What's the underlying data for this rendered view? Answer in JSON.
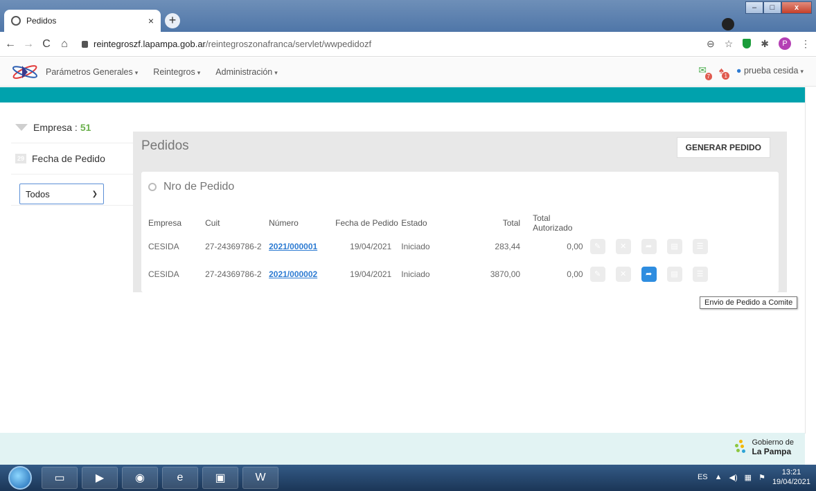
{
  "browser": {
    "tab_title": "Pedidos",
    "tab_close": "×",
    "new_tab": "+",
    "url_domain": "reintegroszf.lapampa.gob.ar",
    "url_path": "/reintegroszonafranca/servlet/wwpedidozf",
    "profile_initial": "P",
    "window_buttons": {
      "minimize": "–",
      "maximize": "□",
      "close": "x"
    }
  },
  "nav": {
    "items": [
      {
        "label": "Parámetros Generales"
      },
      {
        "label": "Reintegros"
      },
      {
        "label": "Administración"
      }
    ],
    "mail_count": "7",
    "alert_count": "1",
    "user": "prueba cesida"
  },
  "sidebar": {
    "empresa_label": "Empresa :",
    "empresa_count": "51",
    "fecha_icon": "29",
    "fecha_label": "Fecha de Pedido",
    "select_value": "Todos"
  },
  "main": {
    "title": "Pedidos",
    "generate_button": "GENERAR PEDIDO",
    "search_placeholder": "Nro de Pedido",
    "columns": [
      "Empresa",
      "Cuit",
      "Número",
      "Fecha de Pedido",
      "Estado",
      "Total",
      "Total Autorizado"
    ],
    "rows": [
      {
        "empresa": "CESIDA",
        "cuit": "27-24369786-2",
        "numero": "2021/000001",
        "fecha": "19/04/2021",
        "estado": "Iniciado",
        "total": "283,44",
        "autorizado": "0,00",
        "send_active": false
      },
      {
        "empresa": "CESIDA",
        "cuit": "27-24369786-2",
        "numero": "2021/000002",
        "fecha": "19/04/2021",
        "estado": "Iniciado",
        "total": "3870,00",
        "autorizado": "0,00",
        "send_active": true
      }
    ],
    "tooltip": "Envio de Pedido a Comite"
  },
  "footer": {
    "logo_line1": "Gobierno de",
    "logo_line2": "La Pampa"
  },
  "taskbar": {
    "lang": "ES",
    "time": "13:21",
    "date": "19/04/2021"
  },
  "colors": {
    "teal": "#00a2ad",
    "link": "#2d7bd2",
    "accent_green": "#6ab04c",
    "active_action": "#2e8de0"
  }
}
